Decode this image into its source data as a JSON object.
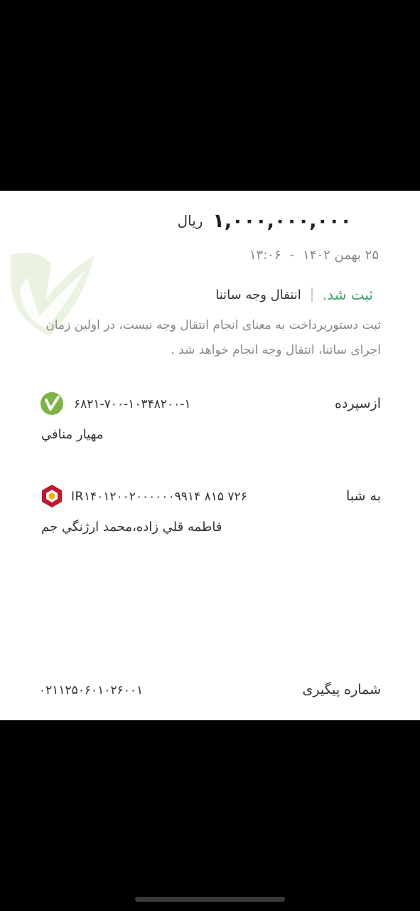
{
  "receipt": {
    "amount": "۱,۰۰۰,۰۰۰,۰۰۰",
    "currency": "ريال",
    "date": "۲۵ بهمن ۱۴۰۲",
    "time_sep": "-",
    "time": "۱۳:۰۶",
    "status": "ثبت شد.",
    "transfer_type": "انتقال وجه ساتنا",
    "notice": "ثبت دستورپرداخت به معنای انجام انتقال وجه نیست، در اولین زمان اجرای ساتنا، انتقال وجه انجام خواهد شد ."
  },
  "from": {
    "label": "ازسپرده",
    "account": "۶۸۲۱-۷۰۰-۱۰۳۴۸۲۰۰-۱",
    "holder": "مهيار منافي",
    "bank_icon": "green-check-bank-logo"
  },
  "to": {
    "label": "به شبا",
    "iban": "IR۱۴۰۱۲۰۰۲۰۰۰۰۰۰۹۹۱۴ ۸۱۵ ۷۲۶",
    "holder": "فاطمه قلي زاده،محمد ارژنگي جم",
    "bank_icon": "red-bank-logo"
  },
  "tracking": {
    "label": "شماره پیگیری",
    "value": "۰۲۱۱۲۵۰۶۰۱۰۲۶۰۰۱"
  },
  "colors": {
    "status_green": "#3aa36a",
    "muted_text": "#888888",
    "bank_red": "#c0182f",
    "bank_green": "#7cb342"
  }
}
